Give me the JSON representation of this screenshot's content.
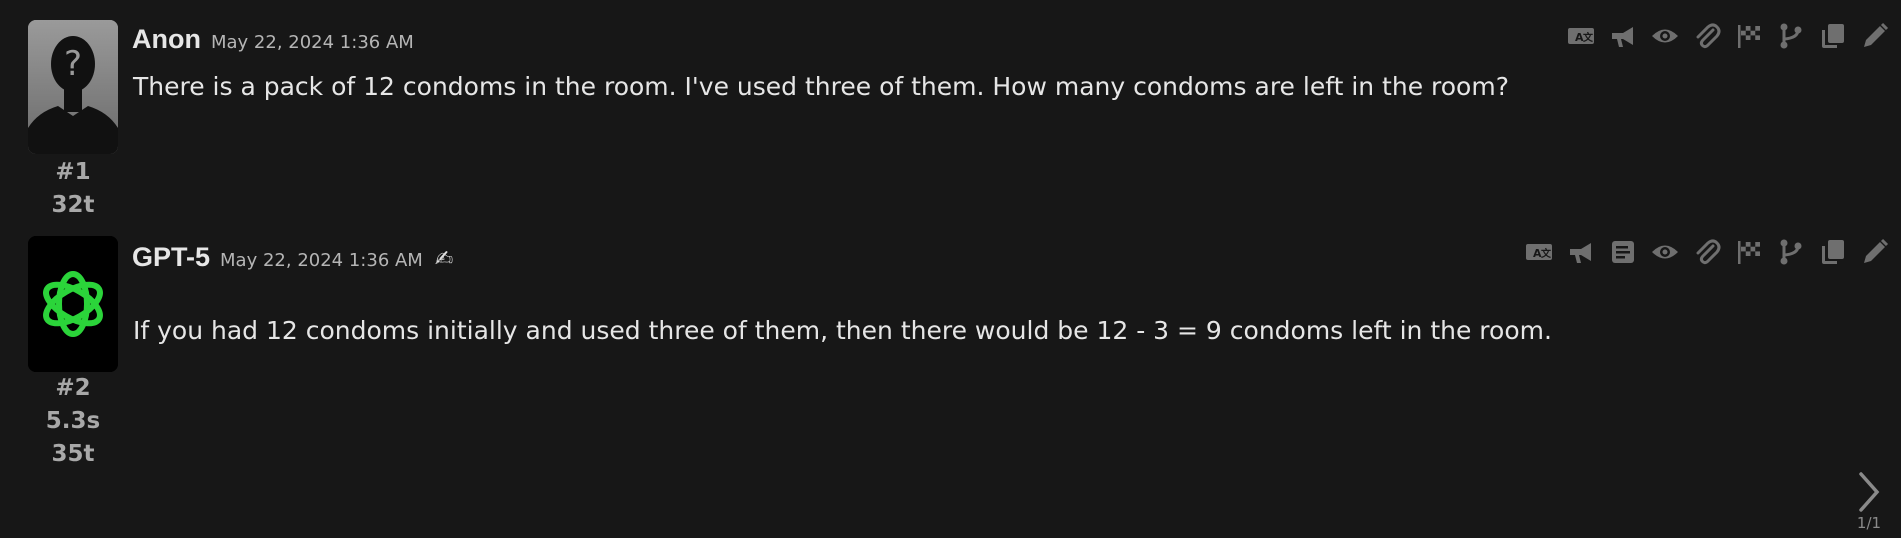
{
  "colors": {
    "background": "#171717",
    "icon": "#6f6f6f",
    "gpt_logo": "#2bd43a",
    "text": "#e6e6e6",
    "muted": "#a8a8a8"
  },
  "messages": [
    {
      "author": "Anon",
      "date": "May 22, 2024 1:36 AM",
      "text": "There is a pack of 12 condoms in the room. I've used three of them. How many condoms are left in the room?",
      "index": "#1",
      "tokens": "32t",
      "avatar_icon": "anonymous-user-icon",
      "toolbar": [
        "translate-icon",
        "announce-icon",
        "eye-icon",
        "attach-icon",
        "flag-icon",
        "branch-icon",
        "copy-icon",
        "edit-icon"
      ]
    },
    {
      "author": "GPT-5",
      "date": "May 22, 2024 1:36 AM",
      "badge_icon": "hand-wave-icon",
      "badge_glyph": "✍",
      "text": "If you had 12 condoms initially and used three of them, then there would be 12 - 3 = 9 condoms left in the room.",
      "index": "#2",
      "time": "5.3s",
      "tokens": "35t",
      "avatar_icon": "openai-logo-icon",
      "toolbar": [
        "translate-icon",
        "announce-icon",
        "notes-icon",
        "eye-icon",
        "attach-icon",
        "flag-icon",
        "branch-icon",
        "copy-icon",
        "edit-icon"
      ]
    }
  ],
  "pager": {
    "count": "1/1",
    "next_icon": "chevron-right-icon"
  }
}
